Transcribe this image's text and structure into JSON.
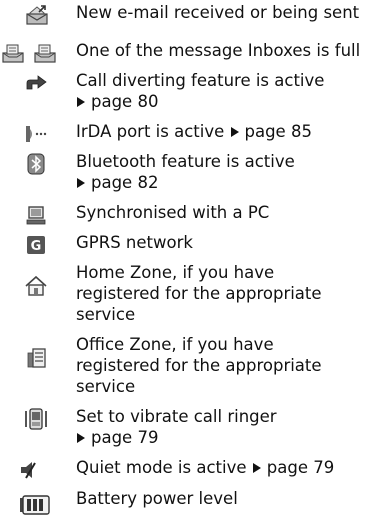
{
  "rows": [
    {
      "icons": [
        "new-email-icon"
      ],
      "lines": [
        "New e-mail received or being sent"
      ]
    },
    {
      "icons": [
        "inbox-full-icon",
        "inbox-full-icon"
      ],
      "lines": [
        "One of the message Inboxes is full"
      ]
    },
    {
      "icons": [
        "call-divert-icon"
      ],
      "lines": [
        "Call diverting feature is active"
      ],
      "page_ref": "page 80"
    },
    {
      "icons": [
        "irda-icon"
      ],
      "lines": [
        "IrDA port is active"
      ],
      "page_ref": "page 85"
    },
    {
      "icons": [
        "bluetooth-icon"
      ],
      "lines": [
        "Bluetooth feature is active"
      ],
      "page_ref": "page 82"
    },
    {
      "icons": [
        "pc-sync-icon"
      ],
      "lines": [
        "Synchronised with a PC"
      ]
    },
    {
      "icons": [
        "gprs-icon"
      ],
      "lines": [
        "GPRS network"
      ],
      "icon_text": "G"
    },
    {
      "icons": [
        "home-zone-icon"
      ],
      "lines": [
        "Home Zone, if you have",
        "registered for the appropriate",
        "service"
      ]
    },
    {
      "icons": [
        "office-zone-icon"
      ],
      "lines": [
        "Office Zone, if you have",
        "registered for the appropriate",
        "service"
      ]
    },
    {
      "icons": [
        "vibrate-icon"
      ],
      "lines": [
        "Set to vibrate call ringer"
      ],
      "page_ref": "page 79"
    },
    {
      "icons": [
        "quiet-mode-icon"
      ],
      "lines": [
        "Quiet mode is active"
      ],
      "page_ref": "page 79"
    },
    {
      "icons": [
        "battery-icon"
      ],
      "lines": [
        "Battery power level"
      ]
    }
  ]
}
